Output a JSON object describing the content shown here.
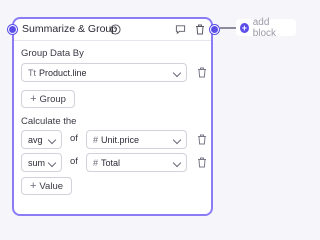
{
  "block": {
    "title": "Summarize & Group",
    "group_label": "Group Data By",
    "group_field": {
      "prefix": "Tt",
      "value": "Product.line"
    },
    "add_group_label": "Group",
    "calculate_label": "Calculate the",
    "aggregations": [
      {
        "func": "avg",
        "of": "of",
        "field_prefix": "#",
        "field": "Unit.price"
      },
      {
        "func": "sum",
        "of": "of",
        "field_prefix": "#",
        "field": "Total"
      }
    ],
    "add_value_label": "Value"
  },
  "add_block_label": "add block",
  "colors": {
    "accent": "#5b4ee8",
    "border": "#8b7cf6"
  }
}
